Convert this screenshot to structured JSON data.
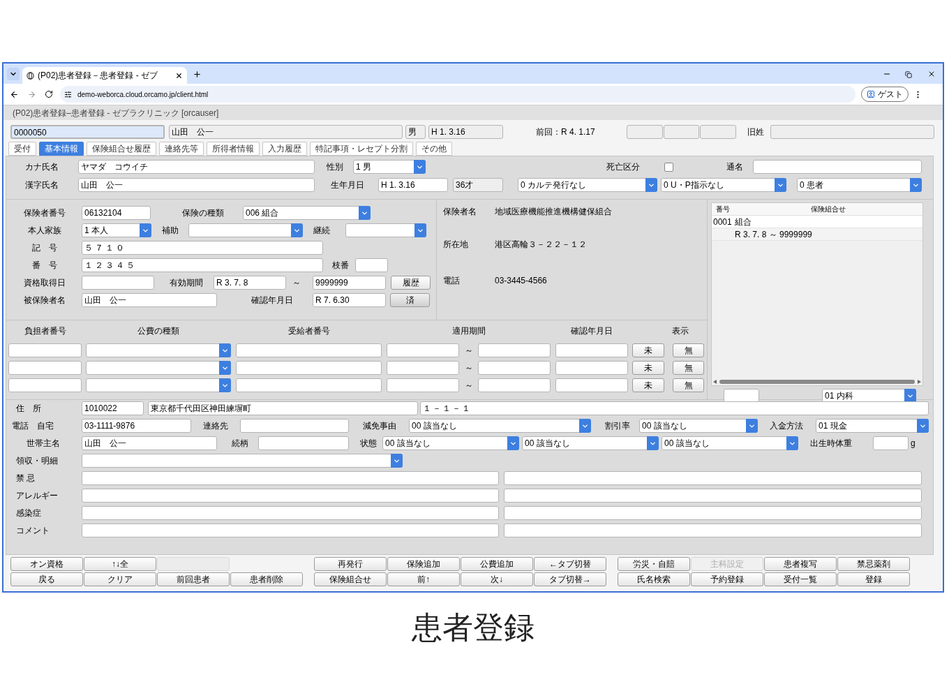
{
  "browser": {
    "tab_title": "(P02)患者登録－患者登録 - ゼブ",
    "url": "demo-weborca.cloud.orcamo.jp/client.html",
    "profile": "ゲスト"
  },
  "app_title": "(P02)患者登録–患者登録 - ゼブラクリニック [orcauser]",
  "header": {
    "patient_id": "0000050",
    "name": "山田　公一",
    "sex": "男",
    "birth": "H 1. 3.16",
    "last_visit": "前回：R 4. 1.17",
    "former_name_label": "旧姓"
  },
  "tabs": [
    {
      "label": "受付",
      "selected": false
    },
    {
      "label": "基本情報",
      "selected": true
    },
    {
      "label": "保険組合せ履歴",
      "selected": false
    },
    {
      "label": "連絡先等",
      "selected": false
    },
    {
      "label": "所得者情報",
      "selected": false
    },
    {
      "label": "入力履歴",
      "selected": false
    },
    {
      "label": "特記事項・レセプト分割",
      "selected": false
    },
    {
      "label": "その他",
      "selected": false
    }
  ],
  "basic": {
    "kana_label": "カナ氏名",
    "kana": "ヤマダ　コウイチ",
    "sex_label": "性別",
    "sex": "1 男",
    "death_label": "死亡区分",
    "death_checked": false,
    "alias_label": "通名",
    "kanji_label": "漢字氏名",
    "kanji": "山田　公一",
    "birth_label": "生年月日",
    "birth": "H 1. 3.16",
    "age": "36才",
    "chart_issue": "0 カルテ発行なし",
    "up_instruction": "0 U・P指示なし",
    "patient_kind": "0 患者"
  },
  "insurance": {
    "insurer_no_label": "保険者番号",
    "insurer_no": "06132104",
    "kind_label": "保険の種類",
    "kind": "006 組合",
    "relation_label": "本人家族",
    "relation": "1 本人",
    "aux_label": "補助",
    "cont_label": "継続",
    "symbol_label": "記　号",
    "symbol": "５７１０",
    "number_label": "番　号",
    "number": "１２３４５",
    "branch_label": "枝番",
    "acquired_label": "資格取得日",
    "valid_label": "有効期間",
    "valid_from": "R 3. 7. 8",
    "tilde": "～",
    "valid_to": "9999999",
    "history_button": "履歴",
    "insured_label": "被保険者名",
    "insured": "山田　公一",
    "confirm_label": "確認年月日",
    "confirm": "R 7. 6.30",
    "done_button": "済"
  },
  "insurer": {
    "name_label": "保険者名",
    "name": "地域医療機能推進機構健保組合",
    "address_label": "所在地",
    "address": "港区高輪３－２２－１２",
    "phone_label": "電話",
    "phone": "03-3445-4566"
  },
  "combinations": {
    "columns": [
      "番号",
      "保険組合せ"
    ],
    "rows": [
      {
        "number": "0001",
        "text": "組合"
      },
      {
        "text": "R 3. 7. 8 ～ 9999999"
      }
    ],
    "department": "01 内科"
  },
  "public_expense": {
    "columns": [
      "負担者番号",
      "公費の種類",
      "受給者番号",
      "適用期間",
      "確認年月日",
      "表示"
    ],
    "rows": [
      {
        "tilde": "～",
        "confirm_button": "未",
        "display_button": "無"
      },
      {
        "tilde": "～",
        "confirm_button": "未",
        "display_button": "無"
      },
      {
        "tilde": "～",
        "confirm_button": "未",
        "display_button": "無"
      }
    ]
  },
  "contact": {
    "address_label": "住　所",
    "zip": "1010022",
    "address1": "東京都千代田区神田練塀町",
    "address2": "１－１－１",
    "phone_label": "電話　自宅",
    "phone": "03-1111-9876",
    "contact_label": "連絡先",
    "reduction_label": "減免事由",
    "reduction": "00 該当なし",
    "discount_label": "割引率",
    "discount": "00 該当なし",
    "payment_label": "入金方法",
    "payment": "01 現金",
    "householder_label": "世帯主名",
    "householder": "山田　公一",
    "relation_label": "続柄",
    "status_label": "状態",
    "statuses": [
      "00 該当なし",
      "00 該当なし",
      "00 該当なし"
    ],
    "birth_weight_label": "出生時体重",
    "unit": "g",
    "receipt_label": "領収・明細"
  },
  "memos": [
    {
      "label": "禁 忌"
    },
    {
      "label": "アレルギー"
    },
    {
      "label": "感染症"
    },
    {
      "label": "コメント"
    }
  ],
  "function_keys": [
    {
      "top": [
        {
          "kind": "button",
          "label": "オン資格",
          "disabled": false
        },
        {
          "kind": "button",
          "label": "↑↓全",
          "disabled": false
        },
        {
          "kind": "blank"
        }
      ],
      "bottom": [
        {
          "kind": "button",
          "label": "戻る",
          "disabled": false
        },
        {
          "kind": "button",
          "label": "クリア",
          "disabled": false
        },
        {
          "kind": "button",
          "label": "前回患者",
          "disabled": false
        },
        {
          "kind": "button",
          "label": "患者削除",
          "disabled": false
        }
      ]
    },
    {
      "top": [
        {
          "kind": "button",
          "label": "再発行",
          "disabled": false
        },
        {
          "kind": "button",
          "label": "保険追加",
          "disabled": false
        },
        {
          "kind": "button",
          "label": "公費追加",
          "disabled": false
        },
        {
          "kind": "button",
          "label": "←タブ切替",
          "disabled": false
        }
      ],
      "bottom": [
        {
          "kind": "button",
          "label": "保険組合せ",
          "disabled": false
        },
        {
          "kind": "button",
          "label": "前↑",
          "disabled": false
        },
        {
          "kind": "button",
          "label": "次↓",
          "disabled": false
        },
        {
          "kind": "button",
          "label": "タブ切替→",
          "disabled": false
        }
      ]
    },
    {
      "top": [
        {
          "kind": "button",
          "label": "労災・自賠",
          "disabled": false
        },
        {
          "kind": "button",
          "label": "主科設定",
          "disabled": true
        },
        {
          "kind": "button",
          "label": "患者複写",
          "disabled": false
        },
        {
          "kind": "button",
          "label": "禁忌薬剤",
          "disabled": false
        }
      ],
      "bottom": [
        {
          "kind": "button",
          "label": "氏名検索",
          "disabled": false
        },
        {
          "kind": "button",
          "label": "予約登録",
          "disabled": false
        },
        {
          "kind": "button",
          "label": "受付一覧",
          "disabled": false
        },
        {
          "kind": "button",
          "label": "登録",
          "disabled": false
        }
      ]
    }
  ],
  "caption": "患者登録"
}
